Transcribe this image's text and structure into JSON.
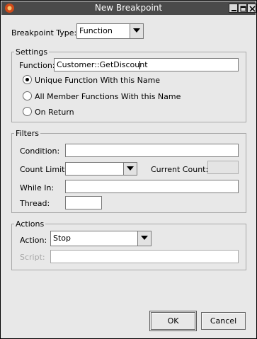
{
  "window": {
    "title": "New Breakpoint"
  },
  "breakpoint_type": {
    "label": "Breakpoint Type:",
    "value": "Function"
  },
  "settings": {
    "title": "Settings",
    "function_label": "Function:",
    "function_value": "Customer::GetDiscount",
    "radios": [
      {
        "label": "Unique Function With this Name",
        "selected": true
      },
      {
        "label": "All Member Functions With this Name",
        "selected": false
      },
      {
        "label": "On Return",
        "selected": false
      }
    ]
  },
  "filters": {
    "title": "Filters",
    "condition_label": "Condition:",
    "condition_value": "",
    "count_limit_label": "Count Limit:",
    "count_limit_value": "",
    "current_count_label": "Current Count:",
    "current_count_value": "",
    "while_in_label": "While In:",
    "while_in_value": "",
    "thread_label": "Thread:",
    "thread_value": ""
  },
  "actions": {
    "title": "Actions",
    "action_label": "Action:",
    "action_value": "Stop",
    "script_label": "Script:",
    "script_value": ""
  },
  "buttons": {
    "ok": "OK",
    "cancel": "Cancel"
  },
  "colors": {
    "titlebar": "#4a4a4a",
    "dialog_bg": "#e8e8e8",
    "border": "#a8a8a8"
  }
}
